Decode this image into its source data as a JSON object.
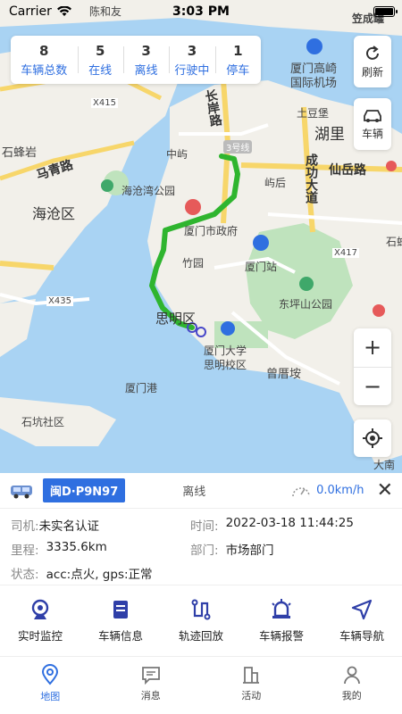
{
  "status": {
    "carrier": "Carrier",
    "time": "3:03 PM"
  },
  "stats": [
    {
      "num": "8",
      "label": "车辆总数"
    },
    {
      "num": "5",
      "label": "在线"
    },
    {
      "num": "3",
      "label": "离线"
    },
    {
      "num": "3",
      "label": "行驶中"
    },
    {
      "num": "1",
      "label": "停车"
    }
  ],
  "side_buttons": {
    "refresh": "刷新",
    "vehicles": "车辆"
  },
  "zoom": {
    "in": "+",
    "out": "−"
  },
  "map_labels": {
    "l1": "陈和友",
    "l2": "笠成罐",
    "l3": "X415",
    "l4": "厦门高崎",
    "l5": "国际机场",
    "l6": "石蜂岩",
    "l7": "中屿",
    "l8": "3号线",
    "l9": "湖里",
    "l10": "仙岳路",
    "l11": "马青路",
    "l12": "海沧湾公园",
    "l13": "屿后",
    "l14": "成功大道",
    "l15": "海沧区",
    "l16": "厦门市政府",
    "l17": "厦门站",
    "l18": "石蜂",
    "l19": "X417",
    "l20": "竹园",
    "l21": "X435",
    "l22": "东坪山公园",
    "l23": "思明区",
    "l24": "厦门大学",
    "l25": "思明校区",
    "l26": "曾厝垵",
    "l27": "厦门港",
    "l28": "石坑社区",
    "l29": "大南",
    "l30": "长岸路",
    "l31": "土豆堡"
  },
  "vehicle": {
    "plate": "闽D·P9N97",
    "state": "离线",
    "speed": "0.0km/h",
    "driver_key": "司机:",
    "driver": "未实名认证",
    "time_key": "时间:",
    "time": "2022-03-18 11:44:25",
    "mileage_key": "里程:",
    "mileage": "3335.6km",
    "dept_key": "部门:",
    "dept": "市场部门",
    "status_key": "状态:",
    "status": "acc:点火, gps:正常"
  },
  "actions": [
    "实时监控",
    "车辆信息",
    "轨迹回放",
    "车辆报警",
    "车辆导航"
  ],
  "tabs": [
    "地图",
    "消息",
    "活动",
    "我的"
  ],
  "colors": {
    "accent": "#2f6fe0",
    "route": "#2fb52f",
    "water": "#a9d3f3",
    "land": "#f2f0ea"
  }
}
